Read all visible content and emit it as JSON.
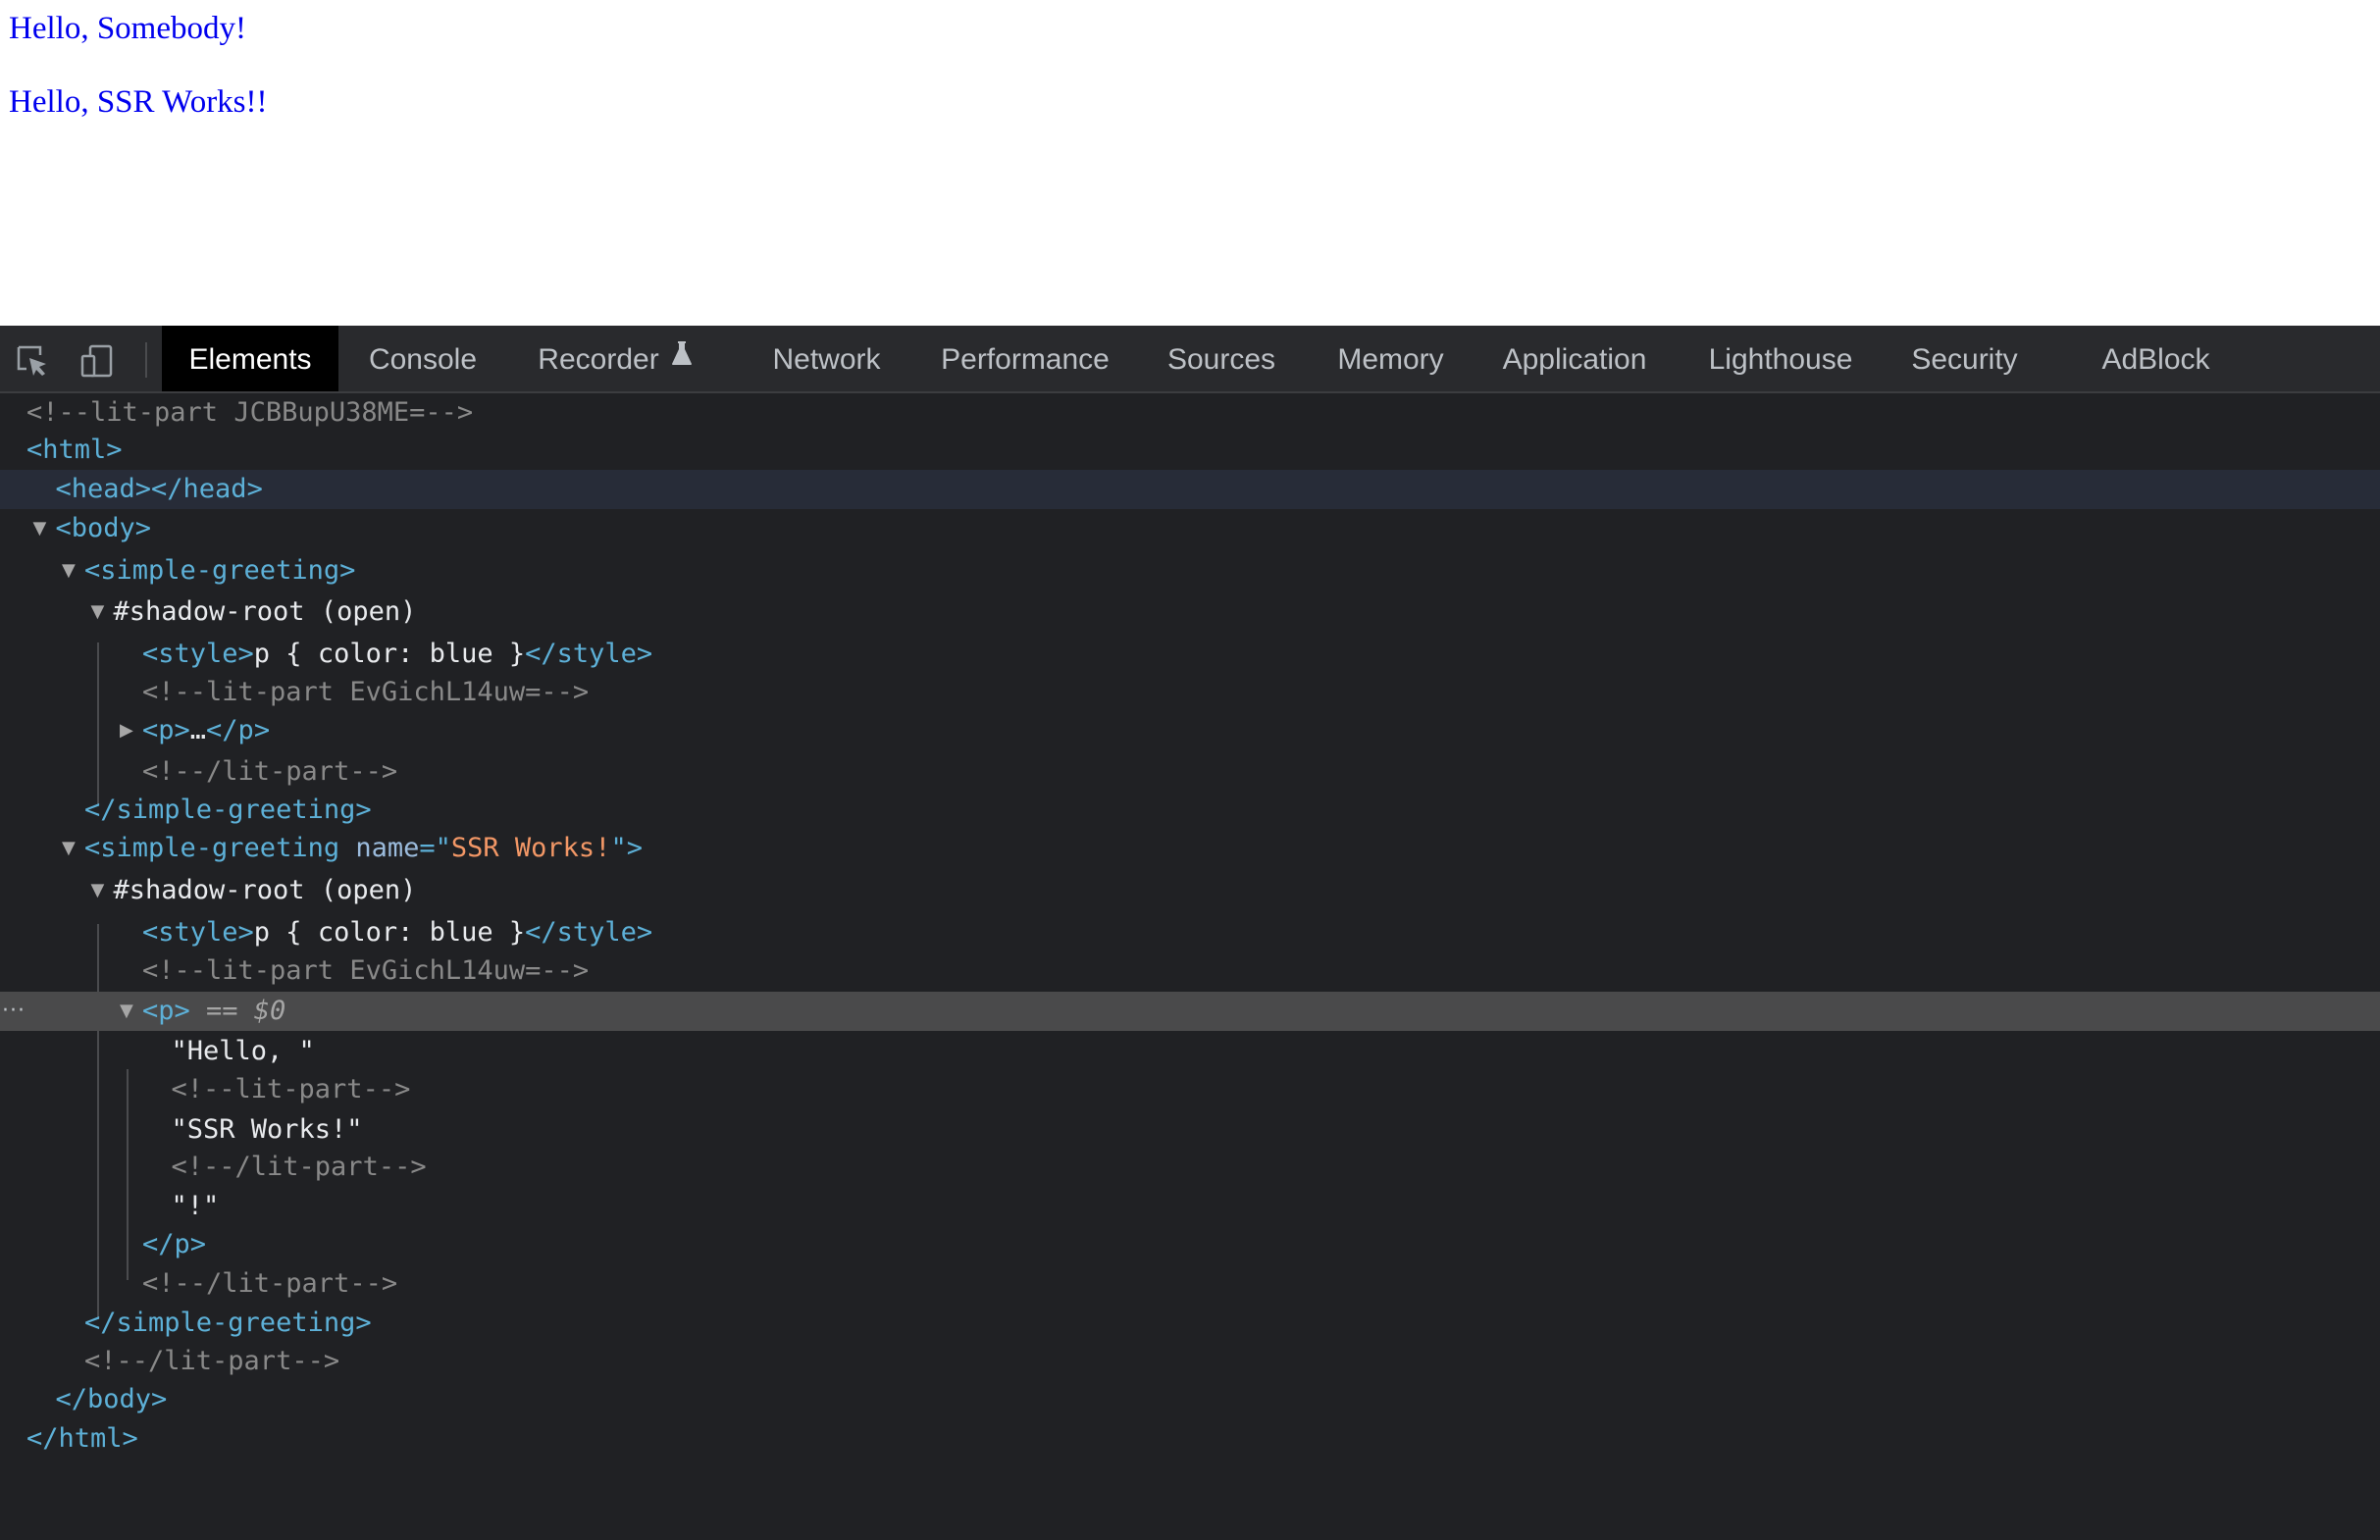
{
  "page": {
    "greetings": [
      "Hello, Somebody!",
      "Hello, SSR Works!!"
    ]
  },
  "devtools": {
    "toolbar_icons": [
      "inspect-element-icon",
      "device-toolbar-icon",
      "flask-icon"
    ],
    "tabs": [
      {
        "label": "Elements",
        "active": true
      },
      {
        "label": "Console"
      },
      {
        "label": "Recorder"
      },
      {
        "label": "Network"
      },
      {
        "label": "Performance"
      },
      {
        "label": "Sources"
      },
      {
        "label": "Memory"
      },
      {
        "label": "Application"
      },
      {
        "label": "Lighthouse"
      },
      {
        "label": "Security"
      },
      {
        "label": "AdBlock"
      }
    ],
    "tree": [
      {
        "depth": 0,
        "tri": "",
        "parts": [
          {
            "c": "cmt",
            "t": "<!--lit-part JCBBupU38ME=-->"
          }
        ]
      },
      {
        "depth": 0,
        "tri": "",
        "parts": [
          {
            "c": "tag",
            "t": "<html>"
          }
        ]
      },
      {
        "depth": 1,
        "tri": "",
        "state": "hover",
        "parts": [
          {
            "c": "tag",
            "t": "<head></head>"
          }
        ]
      },
      {
        "depth": 1,
        "tri": "down",
        "parts": [
          {
            "c": "tag",
            "t": "<body>"
          }
        ]
      },
      {
        "depth": 2,
        "tri": "down",
        "parts": [
          {
            "c": "tag",
            "t": "<simple-greeting>"
          }
        ]
      },
      {
        "depth": 3,
        "tri": "down",
        "parts": [
          {
            "c": "txt",
            "t": "#shadow-root (open)"
          }
        ]
      },
      {
        "depth": 4,
        "tri": "",
        "parts": [
          {
            "c": "tag",
            "t": "<style>"
          },
          {
            "c": "txt",
            "t": "p { color: blue }"
          },
          {
            "c": "tag",
            "t": "</style>"
          }
        ]
      },
      {
        "depth": 4,
        "tri": "",
        "parts": [
          {
            "c": "cmt",
            "t": "<!--lit-part EvGichL14uw=-->"
          }
        ]
      },
      {
        "depth": 4,
        "tri": "right",
        "parts": [
          {
            "c": "tag",
            "t": "<p>"
          },
          {
            "c": "txt",
            "t": "…"
          },
          {
            "c": "tag",
            "t": "</p>"
          }
        ]
      },
      {
        "depth": 4,
        "tri": "",
        "parts": [
          {
            "c": "cmt",
            "t": "<!--/lit-part-->"
          }
        ]
      },
      {
        "depth": 2,
        "tri": "",
        "parts": [
          {
            "c": "tag",
            "t": "</simple-greeting>"
          }
        ]
      },
      {
        "depth": 2,
        "tri": "down",
        "parts": [
          {
            "c": "tag",
            "t": "<simple-greeting "
          },
          {
            "c": "attr",
            "t": "name"
          },
          {
            "c": "tag",
            "t": "=\""
          },
          {
            "c": "val",
            "t": "SSR Works!"
          },
          {
            "c": "tag",
            "t": "\">"
          }
        ]
      },
      {
        "depth": 3,
        "tri": "down",
        "parts": [
          {
            "c": "txt",
            "t": "#shadow-root (open)"
          }
        ]
      },
      {
        "depth": 4,
        "tri": "",
        "parts": [
          {
            "c": "tag",
            "t": "<style>"
          },
          {
            "c": "txt",
            "t": "p { color: blue }"
          },
          {
            "c": "tag",
            "t": "</style>"
          }
        ]
      },
      {
        "depth": 4,
        "tri": "",
        "parts": [
          {
            "c": "cmt",
            "t": "<!--lit-part EvGichL14uw=-->"
          }
        ]
      },
      {
        "depth": 4,
        "tri": "down",
        "state": "selected",
        "parts": [
          {
            "c": "tag",
            "t": "<p>"
          },
          {
            "c": "sel",
            "t": " == $0"
          }
        ]
      },
      {
        "depth": 5,
        "tri": "",
        "parts": [
          {
            "c": "txt",
            "t": "\"Hello, \""
          }
        ]
      },
      {
        "depth": 5,
        "tri": "",
        "parts": [
          {
            "c": "cmt",
            "t": "<!--lit-part-->"
          }
        ]
      },
      {
        "depth": 5,
        "tri": "",
        "parts": [
          {
            "c": "txt",
            "t": "\"SSR Works!\""
          }
        ]
      },
      {
        "depth": 5,
        "tri": "",
        "parts": [
          {
            "c": "cmt",
            "t": "<!--/lit-part-->"
          }
        ]
      },
      {
        "depth": 5,
        "tri": "",
        "parts": [
          {
            "c": "txt",
            "t": "\"!\""
          }
        ]
      },
      {
        "depth": 4,
        "tri": "",
        "parts": [
          {
            "c": "tag",
            "t": "</p>"
          }
        ]
      },
      {
        "depth": 4,
        "tri": "",
        "parts": [
          {
            "c": "cmt",
            "t": "<!--/lit-part-->"
          }
        ]
      },
      {
        "depth": 2,
        "tri": "",
        "parts": [
          {
            "c": "tag",
            "t": "</simple-greeting>"
          }
        ]
      },
      {
        "depth": 2,
        "tri": "",
        "parts": [
          {
            "c": "cmt",
            "t": "<!--/lit-part-->"
          }
        ]
      },
      {
        "depth": 1,
        "tri": "",
        "parts": [
          {
            "c": "tag",
            "t": "</body>"
          }
        ]
      },
      {
        "depth": 0,
        "tri": "",
        "parts": [
          {
            "c": "tag",
            "t": "</html>"
          }
        ]
      }
    ]
  }
}
